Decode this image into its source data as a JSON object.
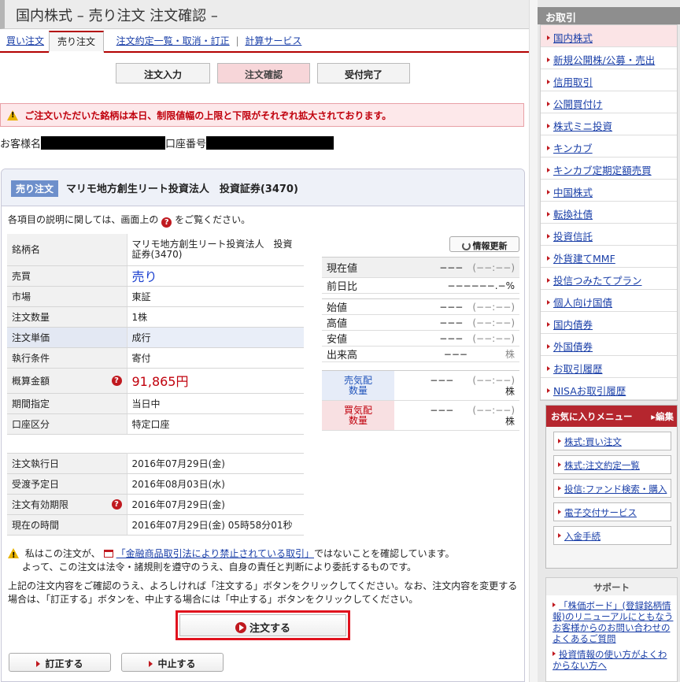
{
  "page": {
    "title": "国内株式 – 売り注文 注文確認 –"
  },
  "tabs": [
    {
      "label": "買い注文"
    },
    {
      "label": "売り注文",
      "active": true
    },
    {
      "label": "注文約定一覧・取消・訂正"
    },
    {
      "label": "計算サービス"
    }
  ],
  "steps": [
    "注文入力",
    "注文確認",
    "受付完了"
  ],
  "alert": "ご注文いただいた銘柄は本日、制限値幅の上限と下限がそれぞれ拡大されております。",
  "customer": {
    "name_label": "お客様名",
    "account_label": "口座番号"
  },
  "order": {
    "tag": "売り注文",
    "stock_name": "マリモ地方創生リート投資法人　投資証券(3470)",
    "help_note_pre": "各項目の説明に関しては、画面上の",
    "help_note_post": "をご覧ください。",
    "rows": [
      {
        "k": "銘柄名",
        "v": "マリモ地方創生リート投資法人　投資証券(3470)"
      },
      {
        "k": "売買",
        "v": "売り"
      },
      {
        "k": "市場",
        "v": "東証"
      },
      {
        "k": "注文数量",
        "v": "1株"
      },
      {
        "k": "注文単価",
        "v": "成行"
      },
      {
        "k": "執行条件",
        "v": "寄付"
      },
      {
        "k": "概算金額",
        "v": "91,865円"
      },
      {
        "k": "期間指定",
        "v": "当日中"
      },
      {
        "k": "口座区分",
        "v": "特定口座"
      }
    ],
    "dates": [
      {
        "k": "注文執行日",
        "v": "2016年07月29日(金)"
      },
      {
        "k": "受渡予定日",
        "v": "2016年08月03日(水)"
      },
      {
        "k": "注文有効期限",
        "v": "2016年07月29日(金)"
      },
      {
        "k": "現在の時間",
        "v": "2016年07月29日(金) 05時58分01秒"
      }
    ]
  },
  "quote": {
    "refresh": "情報更新",
    "current_label": "現在値",
    "current_value": "−−−",
    "current_change": "(−−:−−)",
    "diff_label": "前日比",
    "diff_value": "−−−",
    "diff_pct": "−−−.−%",
    "rows": [
      {
        "k": "始値",
        "v": "−−−",
        "t": "(−−:−−)"
      },
      {
        "k": "高値",
        "v": "−−−",
        "t": "(−−:−−)"
      },
      {
        "k": "安値",
        "v": "−−−",
        "t": "(−−:−−)"
      },
      {
        "k": "出来高",
        "v": "−−−",
        "t": "株"
      }
    ],
    "sell_label": "売気配\n数量",
    "sell_v": "−−−",
    "sell_t": "(−−:−−)",
    "sell_u": "株",
    "buy_label": "買気配\n数量",
    "buy_v": "−−−",
    "buy_t": "(−−:−−)",
    "buy_u": "株",
    "v2": "−−−"
  },
  "confirm": {
    "pre": "私はこの注文が、",
    "link": "「金融商品取引法により禁止されている取引」",
    "post": "ではないことを確認しています。",
    "line2": "よって、この注文は法令・諸規則を遵守のうえ、自身の責任と判断により委託するものです。",
    "instruction": "上記の注文内容をご確認のうえ、よろしければ「注文する」ボタンをクリックしてください。なお、注文内容を変更する場合は、「訂正する」ボタンを、中止する場合には「中止する」ボタンをクリックしてください。"
  },
  "buttons": {
    "order": "注文する",
    "correct": "訂正する",
    "cancel": "中止する"
  },
  "sidebar": {
    "title": "お取引",
    "items": [
      "国内株式",
      "新規公開株/公募・売出",
      "信用取引",
      "公開買付け",
      "株式ミニ投資",
      "キンカブ",
      "キンカブ定期定額売買",
      "中国株式",
      "転換社債",
      "投資信託",
      "外貨建てMMF",
      "投信つみたてプラン",
      "個人向け国債",
      "国内債券",
      "外国債券",
      "お取引履歴",
      "NISAお取引履歴"
    ]
  },
  "favorites": {
    "title": "お気に入りメニュー",
    "edit": "編集",
    "items": [
      "株式:買い注文",
      "株式:注文約定一覧",
      "投信:ファンド検索・購入",
      "電子交付サービス",
      "入金手続"
    ]
  },
  "support": {
    "title": "サポート",
    "items": [
      "「株価ボード」(登録銘柄情報)のリニューアルにともなうお客様からのお問い合わせのよくあるご質問",
      "投資情報の使い方がよくわからない方へ"
    ]
  }
}
